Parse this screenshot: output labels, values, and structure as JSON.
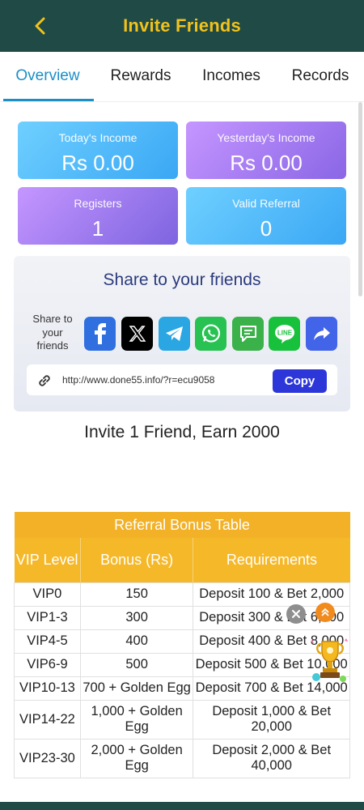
{
  "header": {
    "title": "Invite Friends"
  },
  "tabs": [
    {
      "label": "Overview"
    },
    {
      "label": "Rewards"
    },
    {
      "label": "Incomes"
    },
    {
      "label": "Records"
    }
  ],
  "stats": [
    {
      "label": "Today's Income",
      "value": "Rs 0.00"
    },
    {
      "label": "Yesterday's Income",
      "value": "Rs 0.00"
    },
    {
      "label": "Registers",
      "value": "1"
    },
    {
      "label": "Valid Referral",
      "value": "0"
    }
  ],
  "share": {
    "title": "Share to your friends",
    "label": "Share to your friends",
    "link": "http://www.done55.info/?r=ecu9058",
    "copy_label": "Copy",
    "socials": [
      "facebook-icon",
      "x-icon",
      "telegram-icon",
      "whatsapp-icon",
      "sms-icon",
      "line-icon",
      "share-arrow-icon"
    ]
  },
  "invite_text": "Invite 1 Friend, Earn 2000",
  "bonus_table": {
    "title": "Referral Bonus Table",
    "headers": [
      "VIP Level",
      "Bonus (Rs)",
      "Requirements"
    ],
    "rows": [
      [
        "VIP0",
        "150",
        "Deposit 100 & Bet 2,000"
      ],
      [
        "VIP1-3",
        "300",
        "Deposit 300 & Bet 6,000"
      ],
      [
        "VIP4-5",
        "400",
        "Deposit 400 & Bet 8,000"
      ],
      [
        "VIP6-9",
        "500",
        "Deposit 500 & Bet 10,000"
      ],
      [
        "VIP10-13",
        "700 + Golden Egg",
        "Deposit 700 & Bet 14,000"
      ],
      [
        "VIP14-22",
        "1,000 + Golden Egg",
        "Deposit 1,000 & Bet 20,000"
      ],
      [
        "VIP23-30",
        "2,000 + Golden Egg",
        "Deposit 2,000 & Bet 40,000"
      ]
    ]
  },
  "colors": {
    "header_bg": "#1f4a46",
    "accent_yellow": "#f2c21c",
    "tab_active": "#1c8fc7",
    "table_header": "#f5b829",
    "copy_button": "#2d37d9"
  }
}
